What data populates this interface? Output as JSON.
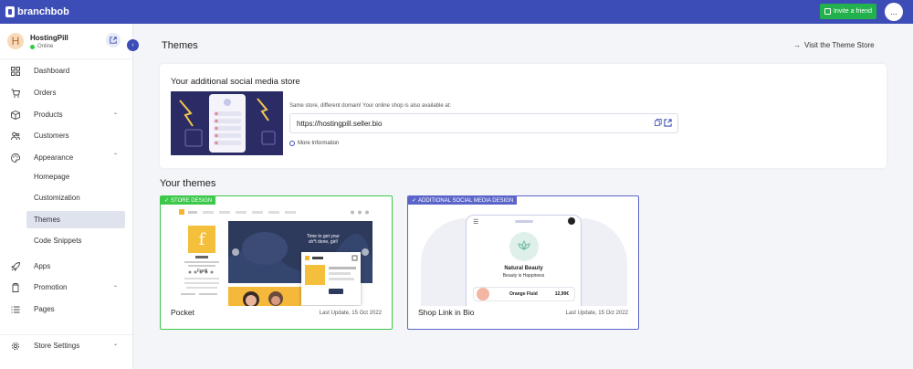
{
  "topbar": {
    "brand": "branchbob",
    "invite_label": "Invite a friend",
    "avatar_text": "..."
  },
  "store": {
    "initial": "H",
    "name": "HostingPill",
    "status": "Online"
  },
  "sidebar": {
    "items": [
      {
        "label": "Dashboard"
      },
      {
        "label": "Orders"
      },
      {
        "label": "Products"
      },
      {
        "label": "Customers"
      },
      {
        "label": "Appearance"
      },
      {
        "label": "Apps"
      },
      {
        "label": "Promotion"
      },
      {
        "label": "Pages"
      },
      {
        "label": "Store Settings"
      }
    ],
    "appearance_sub": [
      {
        "label": "Homepage"
      },
      {
        "label": "Customization"
      },
      {
        "label": "Themes"
      },
      {
        "label": "Code Snippets"
      }
    ]
  },
  "main": {
    "title": "Themes",
    "visit_link": "Visit the Theme Store",
    "social_store": {
      "title": "Your additional social media store",
      "description": "Same store, different domain! Your online shop is also available at:",
      "url": "https://hostingpill.seller.bio",
      "more_info": "More Information"
    },
    "your_themes_heading": "Your themes",
    "themes": [
      {
        "badge": "STORE DESIGN",
        "name": "Pocket",
        "updated": "Last Update, 15 Oct 2022",
        "preview": {
          "banner_text": "Time to get your sh*t done, girl!",
          "brand": "Fredi"
        }
      },
      {
        "badge": "ADDITIONAL SOCIAL MEDIA DESIGN",
        "name": "Shop Link in Bio",
        "updated": "Last Update, 15 Oct 2022",
        "preview": {
          "brand": "Natural Beauty",
          "tagline": "Beauty is Happiness",
          "product_name": "Orange Fluid",
          "product_price": "12,99€"
        }
      }
    ]
  },
  "colors": {
    "primary": "#3d4db7",
    "invite_green": "#22b14c",
    "store_badge": "#3cc84a",
    "social_badge": "#5b65c9"
  }
}
